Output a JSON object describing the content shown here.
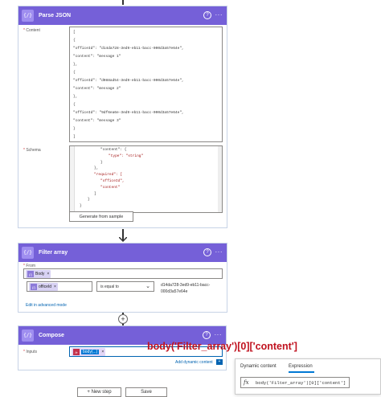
{
  "parse": {
    "title": "Parse JSON",
    "help": "?",
    "more": "···",
    "content_label": "Content",
    "content_lines": [
      "[",
      "{",
      "\"officeId\": \"d14da728-3ed9-eb11-bacc-000d3a57e64e\",",
      "\"content\": \"message 1\"",
      "},",
      "{",
      "\"officeId\": \"d088ad54-3ed9-eb11-bacc-000d3a57e64e\",",
      "\"content\": \"message 2\"",
      "},",
      "{",
      "\"officeId\": \"9df6ea6e-3ed9-eb11-bacc-000d3a57e64e\",",
      "\"content\": \"message 3\"",
      "}",
      "]"
    ],
    "schema_label": "Schema",
    "schema_lines": [
      "\"content\": {",
      "\"type\": \"string\"",
      "}",
      "},",
      "\"required\": [",
      "\"officeId\",",
      "\"content\"",
      "]",
      "}",
      "}"
    ],
    "generate_button": "Generate from sample"
  },
  "filter": {
    "title": "Filter array",
    "from_label": "From",
    "from_token": "Body",
    "left_token": "officeId",
    "operator": "is equal to",
    "right_value_1": "d14da728-3ed9-eb11-bacc-",
    "right_value_2": "000d3a57e64e",
    "advanced_link": "Edit in advanced mode"
  },
  "compose": {
    "title": "Compose",
    "inputs_label": "Inputs",
    "token_label": "body(...)",
    "expression_overlay": "body('Filter_array')[0]['content']",
    "add_dynamic": "Add dynamic content"
  },
  "panel": {
    "tab_dynamic": "Dynamic content",
    "tab_expression": "Expression",
    "expression_value": "body('Filter_array')[0]['content']"
  },
  "footer": {
    "new_step": "+ New step",
    "save": "Save"
  },
  "colors": {
    "accent": "#7560d8",
    "link": "#0063b1",
    "expression_red": "#c0121f"
  }
}
